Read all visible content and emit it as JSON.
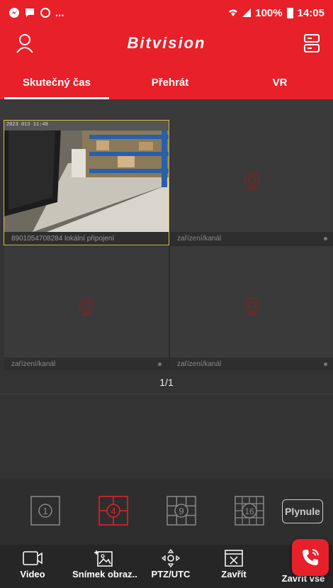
{
  "status_bar": {
    "left_icons": [
      "messenger-icon",
      "chat-icon",
      "whatsapp-icon"
    ],
    "ellipsis": "...",
    "battery": "100%",
    "time": "14:05"
  },
  "header": {
    "title": "Bitvision"
  },
  "tabs": [
    {
      "label": "Skutečný čas",
      "active": true
    },
    {
      "label": "Přehrát",
      "active": false
    },
    {
      "label": "VR",
      "active": false
    }
  ],
  "grid": {
    "cells": [
      {
        "footer": "8901054708284 lokální připojení",
        "live": true,
        "timestamp": "2023 013 11:48"
      },
      {
        "footer": "zařízení/kanál",
        "live": false
      },
      {
        "footer": "zařízení/kanál",
        "live": false
      },
      {
        "footer": "zařízení/kanál",
        "live": false
      }
    ]
  },
  "pager": {
    "text": "1/1"
  },
  "layouts": {
    "one": "1",
    "four": "4",
    "nine": "9",
    "sixteen": "16",
    "smooth": "Plynule"
  },
  "bottom_nav": [
    {
      "label": "Video",
      "icon": "video-icon"
    },
    {
      "label": "Snímek obraz..",
      "icon": "snapshot-icon"
    },
    {
      "label": "PTZ/UTC",
      "icon": "ptz-icon"
    },
    {
      "label": "Zavřít",
      "icon": "close-window-icon"
    },
    {
      "label": "Zavřít vše",
      "icon": "close-all-icon"
    }
  ],
  "colors": {
    "brand": "#e8202a",
    "background": "#333333",
    "selection": "#d4c23a"
  }
}
